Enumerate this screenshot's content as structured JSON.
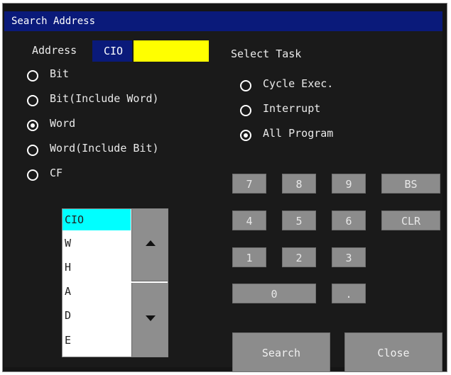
{
  "window": {
    "title": "Search Address"
  },
  "address": {
    "label": "Address",
    "area": "CIO",
    "value": ""
  },
  "search_types": [
    {
      "label": "Bit",
      "selected": false
    },
    {
      "label": "Bit(Include Word)",
      "selected": false
    },
    {
      "label": "Word",
      "selected": true
    },
    {
      "label": "Word(Include Bit)",
      "selected": false
    },
    {
      "label": "CF",
      "selected": false
    }
  ],
  "task": {
    "label": "Select Task",
    "options": [
      {
        "label": "Cycle Exec.",
        "selected": false
      },
      {
        "label": "Interrupt",
        "selected": false
      },
      {
        "label": "All Program",
        "selected": true
      }
    ]
  },
  "area_list": {
    "items": [
      "CIO",
      "W",
      "H",
      "A",
      "D",
      "E"
    ],
    "selected": "CIO"
  },
  "keypad": {
    "k7": "7",
    "k8": "8",
    "k9": "9",
    "bs": "BS",
    "k4": "4",
    "k5": "5",
    "k6": "6",
    "clr": "CLR",
    "k1": "1",
    "k2": "2",
    "k3": "3",
    "k0": "0",
    "dot": "."
  },
  "buttons": {
    "search": "Search",
    "close": "Close"
  },
  "colors": {
    "title_bg": "#0a1a7a",
    "input_bg": "#ffff00",
    "list_selected": "#00ffff",
    "panel_bg": "#1a1a1a",
    "button_bg": "#8c8c8c"
  }
}
